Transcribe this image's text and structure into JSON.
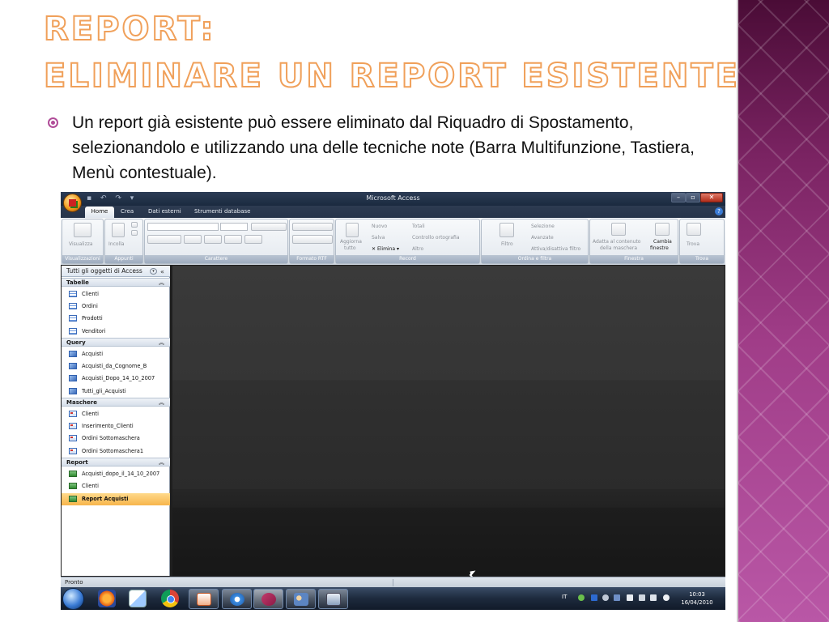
{
  "slide": {
    "title_line1": "REPORT:",
    "title_line2": "ELIMINARE UN REPORT ESISTENTE",
    "bullet": "Un report già esistente può essere eliminato dal Riquadro di Spostamento, selezionandolo e utilizzando una delle tecniche note (Barra Multifunzione, Tastiera, Menù contestuale)."
  },
  "window": {
    "title": "Microsoft Access",
    "tabs": [
      "Home",
      "Crea",
      "Dati esterni",
      "Strumenti database"
    ]
  },
  "ribbon": {
    "groups": [
      "Visualizzazioni",
      "Appunti",
      "Carattere",
      "Formato RTF",
      "Record",
      "Ordina e filtra",
      "Finestra",
      "Trova"
    ],
    "visualizza": "Visualizza",
    "incolla": "Incolla",
    "aggiorna": "Aggiorna",
    "tutto": "tutto",
    "nuovo": "Nuovo",
    "totali": "Totali",
    "salva": "Salva",
    "controllo": "Controllo ortografia",
    "elimina": "Elimina",
    "altro": "Altro",
    "filtro": "Filtro",
    "selezione": "Selezione",
    "avanzate": "Avanzate",
    "attiva": "Attiva/disattiva filtro",
    "adatta1": "Adatta al contenuto",
    "adatta2": "della maschera",
    "cambia1": "Cambia",
    "cambia2": "finestre",
    "trova": "Trova"
  },
  "nav": {
    "header": "Tutti gli oggetti di Access",
    "sections": {
      "tabelle": "Tabelle",
      "query": "Query",
      "maschere": "Maschere",
      "report": "Report"
    },
    "tabelle": [
      "Clienti",
      "Ordini",
      "Prodotti",
      "Venditori"
    ],
    "query": [
      "Acquisti",
      "Acquisti_da_Cognome_B",
      "Acquisti_Dopo_14_10_2007",
      "Tutti_gli_Acquisti"
    ],
    "maschere": [
      "Clienti",
      "Inserimento_Clienti",
      "Ordini Sottomaschera",
      "Ordini Sottomaschera1"
    ],
    "report": [
      "Acquisti_dopo_il_14_10_2007",
      "Clienti",
      "Report Acquisti"
    ]
  },
  "status": "Pronto",
  "taskbar": {
    "lang": "IT",
    "time": "10:03",
    "date": "16/04/2010"
  },
  "colors": {
    "accent": "#b04c98",
    "title_outline": "#f0a05a",
    "selected_item": "#f7b54c"
  }
}
